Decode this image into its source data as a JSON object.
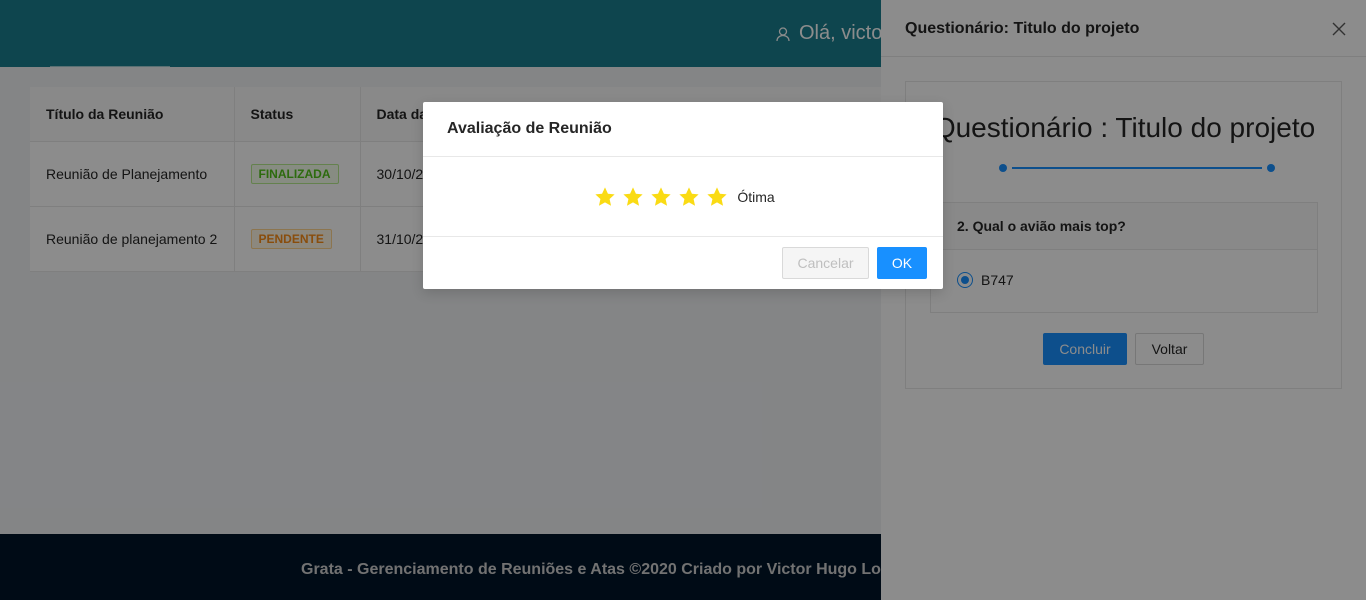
{
  "header": {
    "greeting": "Olá, victo"
  },
  "table": {
    "columns": [
      "Título da Reunião",
      "Status",
      "Data da"
    ],
    "rows": [
      {
        "title": "Reunião de Planejamento",
        "status": "FINALIZADA",
        "date": "30/10/2"
      },
      {
        "title": "Reunião de planejamento 2",
        "status": "PENDENTE",
        "date": "31/10/2"
      }
    ]
  },
  "footer": {
    "text": "Grata - Gerenciamento de Reuniões e Atas ©2020 Criado por Victor Hugo Lo"
  },
  "drawer": {
    "title": "Questionário: Titulo do projeto",
    "heading": "Questionário : Titulo do projeto",
    "question": "2. Qual o avião mais top?",
    "option": "B747",
    "conclude_label": "Concluir",
    "back_label": "Voltar"
  },
  "modal": {
    "title": "Avaliação de Reunião",
    "rating": 5,
    "rating_max": 5,
    "rating_text": "Ótima",
    "cancel_label": "Cancelar",
    "ok_label": "OK"
  },
  "colors": {
    "header_bg": "#1a7f8e",
    "primary": "#1890ff",
    "star": "#fadb14",
    "status_finalizada": "#52c41a",
    "status_pendente": "#fa8c16"
  }
}
